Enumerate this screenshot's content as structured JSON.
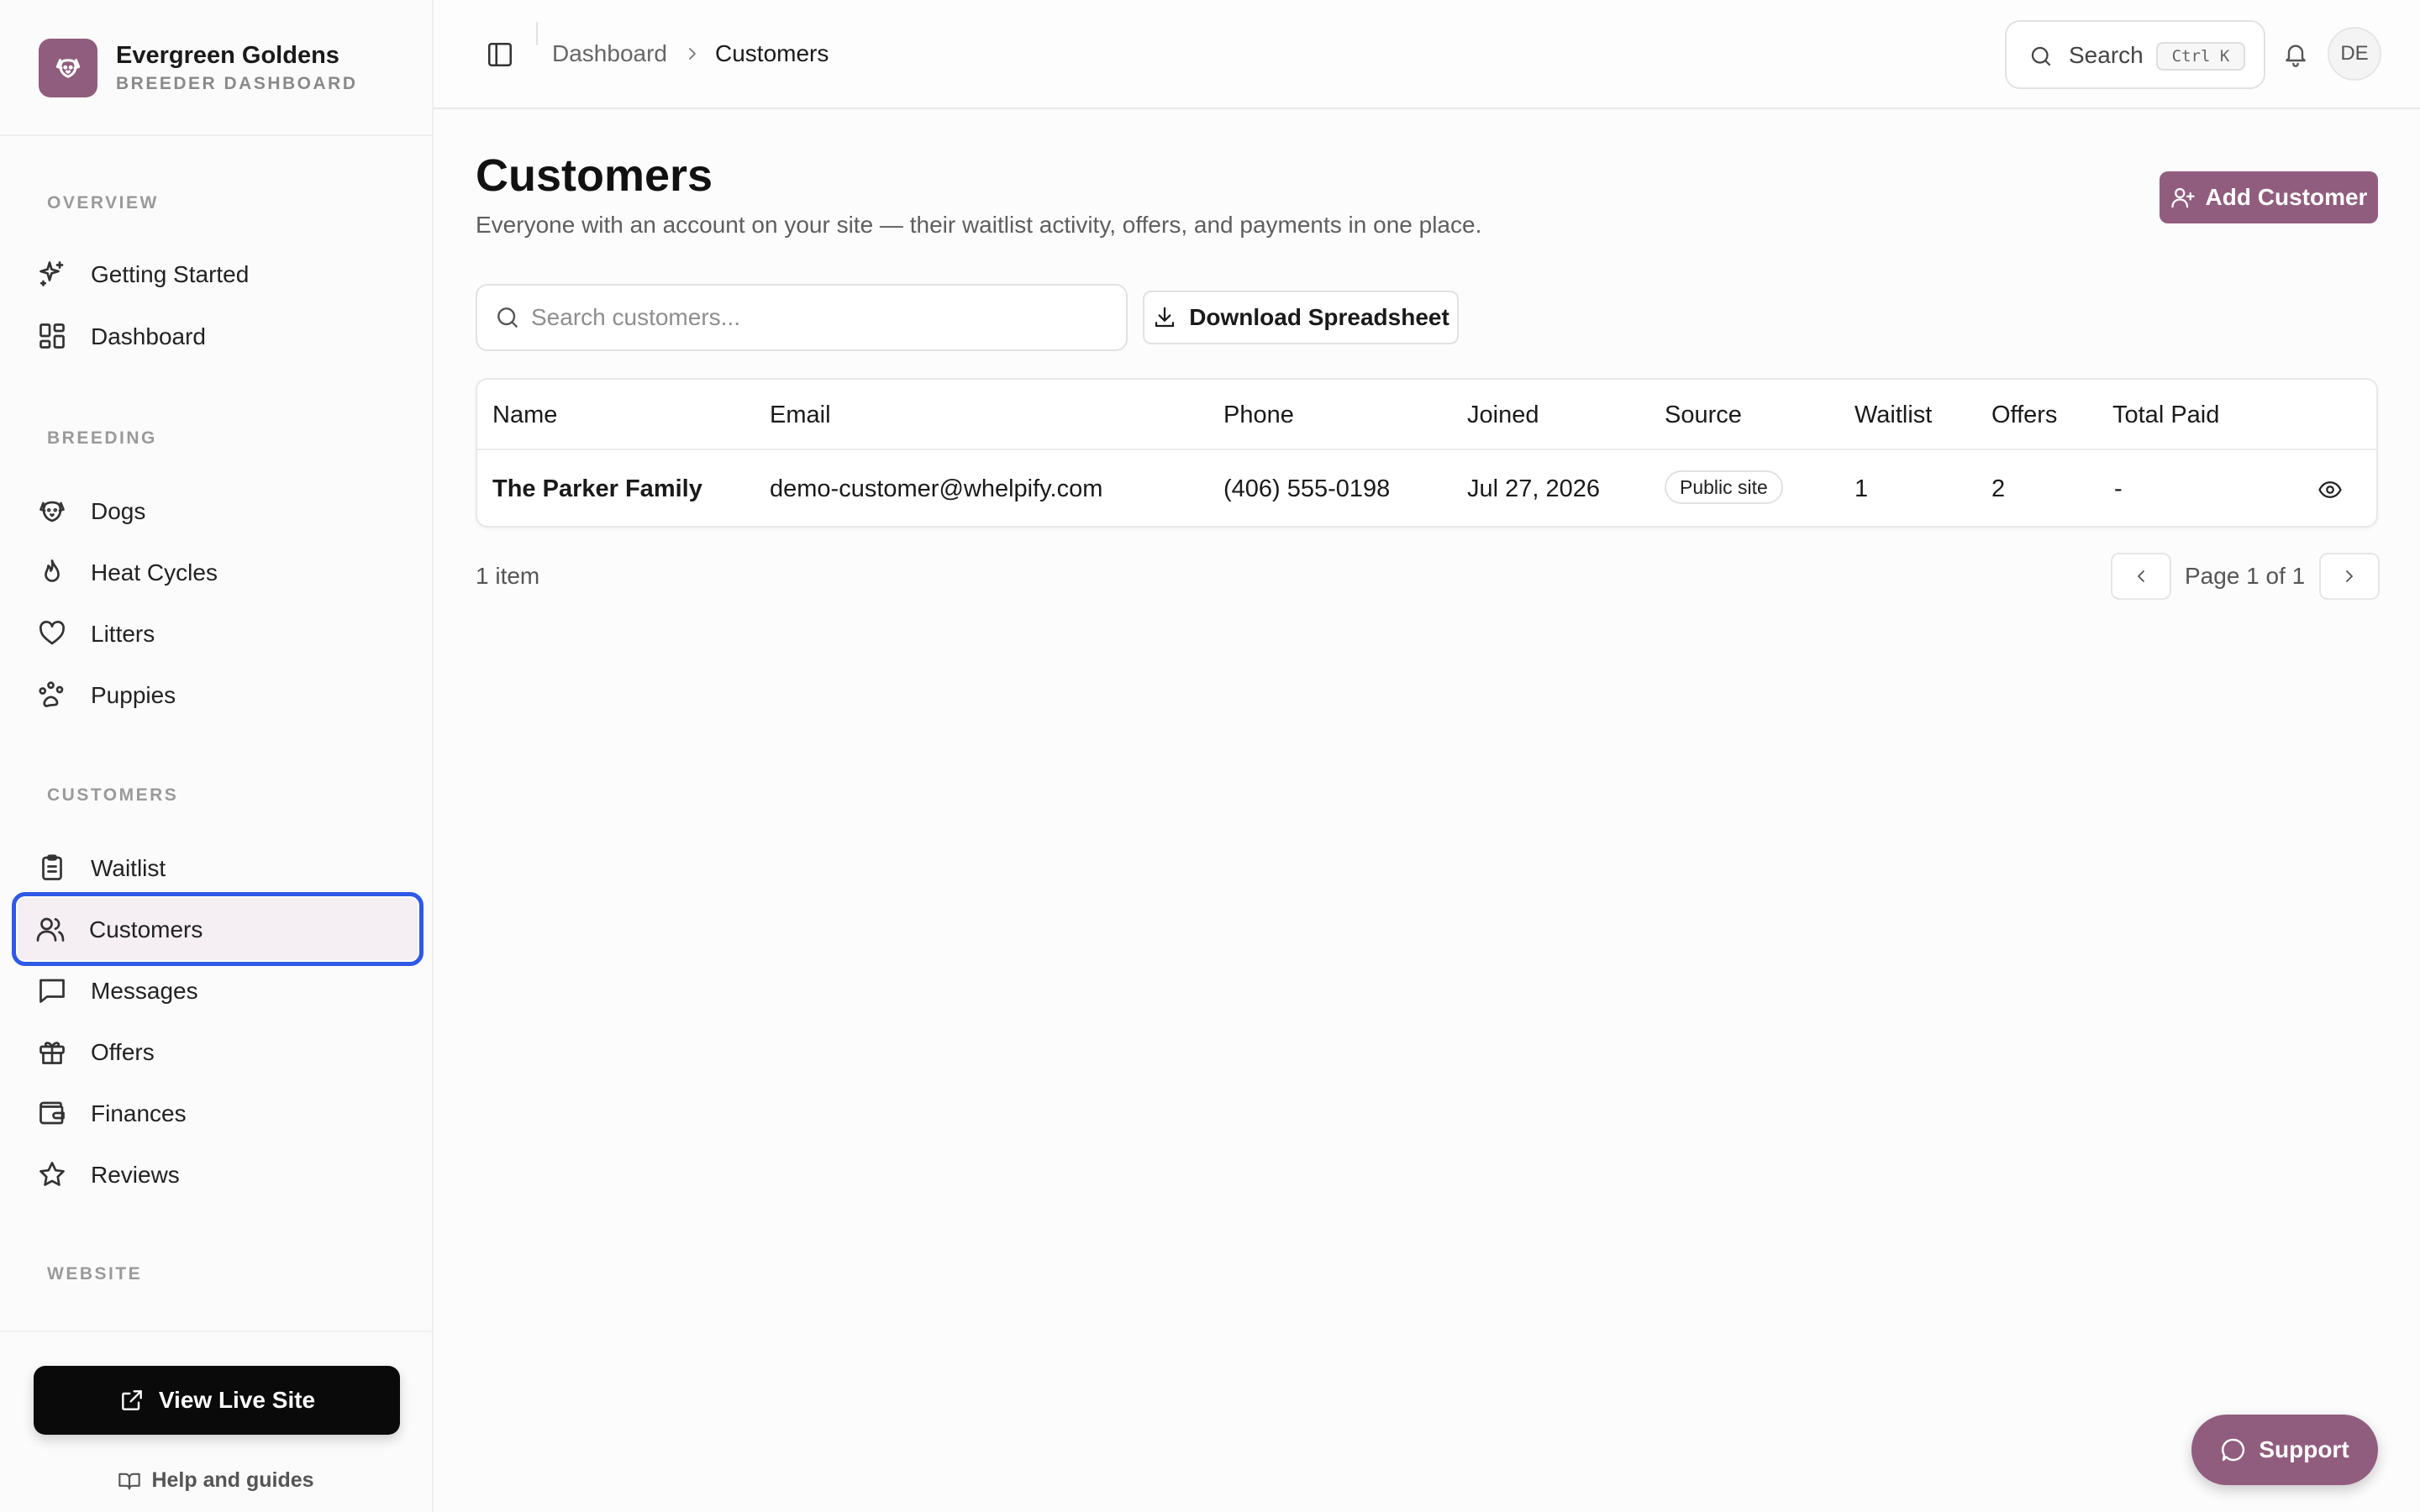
{
  "brand": {
    "name": "Evergreen Goldens",
    "subtitle": "BREEDER DASHBOARD",
    "logo_icon": "dog-face-icon"
  },
  "colors": {
    "accent": "#915d7e",
    "focus_ring": "#2f59e6",
    "active_bg": "#f5eef2",
    "dark_button": "#0a0a0a"
  },
  "sidebar": {
    "sections": [
      {
        "label": "OVERVIEW",
        "items": [
          {
            "label": "Getting Started",
            "icon": "sparkles-icon"
          },
          {
            "label": "Dashboard",
            "icon": "grid-icon"
          }
        ]
      },
      {
        "label": "BREEDING",
        "items": [
          {
            "label": "Dogs",
            "icon": "dog-icon"
          },
          {
            "label": "Heat Cycles",
            "icon": "flame-icon"
          },
          {
            "label": "Litters",
            "icon": "heart-icon"
          },
          {
            "label": "Puppies",
            "icon": "paw-icon"
          }
        ]
      },
      {
        "label": "CUSTOMERS",
        "items": [
          {
            "label": "Waitlist",
            "icon": "clipboard-icon"
          },
          {
            "label": "Customers",
            "icon": "users-icon",
            "active": true
          },
          {
            "label": "Messages",
            "icon": "message-icon"
          },
          {
            "label": "Offers",
            "icon": "gift-icon"
          },
          {
            "label": "Finances",
            "icon": "wallet-icon"
          },
          {
            "label": "Reviews",
            "icon": "star-icon"
          }
        ]
      },
      {
        "label": "WEBSITE",
        "items": []
      }
    ],
    "footer": {
      "view_live_site": "View Live Site",
      "help": "Help and guides"
    }
  },
  "topbar": {
    "breadcrumb": [
      "Dashboard",
      "Customers"
    ],
    "search_label": "Search",
    "search_shortcut": "Ctrl K",
    "avatar_initials": "DE"
  },
  "main": {
    "title": "Customers",
    "subtitle": "Everyone with an account on your site — their waitlist activity, offers, and payments in one place.",
    "add_button": "Add Customer",
    "search_placeholder": "Search customers...",
    "download_button": "Download Spreadsheet",
    "table": {
      "columns": [
        "Name",
        "Email",
        "Phone",
        "Joined",
        "Source",
        "Waitlist",
        "Offers",
        "Total Paid"
      ],
      "rows": [
        {
          "name": "The Parker Family",
          "email": "demo-customer@whelpify.com",
          "phone": "(406) 555-0198",
          "joined": "Jul 27, 2026",
          "source": "Public site",
          "waitlist": "1",
          "offers": "2",
          "total_paid": "-"
        }
      ]
    },
    "item_count": "1 item",
    "pagination": "Page 1 of 1"
  },
  "support_button": "Support"
}
